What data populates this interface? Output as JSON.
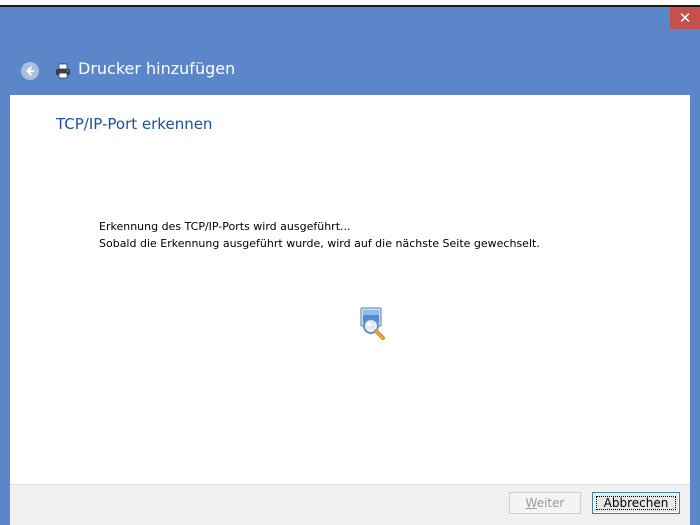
{
  "window": {
    "title": "Drucker hinzufügen",
    "close_glyph": "✕"
  },
  "page": {
    "heading": "TCP/IP-Port erkennen",
    "status_line_1": "Erkennung des TCP/IP-Ports wird ausgeführt...",
    "status_line_2": "Sobald die Erkennung ausgeführt wurde, wird auf die nächste Seite gewechselt."
  },
  "footer": {
    "next_label_accel": "W",
    "next_label_rest": "eiter",
    "next_enabled": false,
    "cancel_label": "Abbrechen"
  },
  "icons": {
    "back": "back-arrow-icon",
    "printer": "printer-icon",
    "busy": "searching-computer-icon"
  },
  "colors": {
    "titlebar": "#5b86c9",
    "heading": "#1f4fa0",
    "close": "#c7504f"
  }
}
